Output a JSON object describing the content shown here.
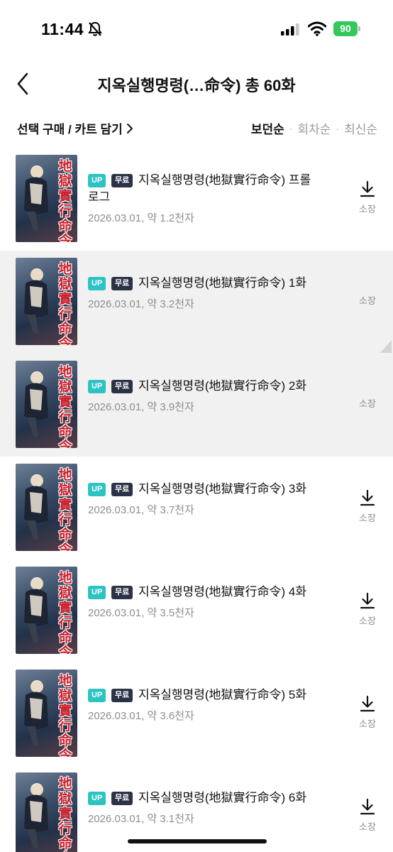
{
  "status_bar": {
    "time": "11:44",
    "battery": "90"
  },
  "header": {
    "title": "지옥실행명령(…命令) 총 60화"
  },
  "toolbar": {
    "select_label": "선택 구매 / 카트 담기",
    "sort_options": [
      "보던순",
      "회차순",
      "최신순"
    ],
    "sort_active": "보던순"
  },
  "episodes": [
    {
      "up": "UP",
      "free": "무료",
      "title": "지옥실행명령(地獄實行命令) 프롤로그",
      "meta": "2026.03.01, 약 1.2천자",
      "action": "소장",
      "read": false,
      "download": true,
      "cover_text": "地獄實行命令"
    },
    {
      "up": "UP",
      "free": "무료",
      "title": "지옥실행명령(地獄實行命令) 1화",
      "meta": "2026.03.01, 약 3.2천자",
      "action": "소장",
      "read": true,
      "download": false,
      "cover_text": "地獄實行命令"
    },
    {
      "up": "UP",
      "free": "무료",
      "title": "지옥실행명령(地獄實行命令) 2화",
      "meta": "2026.03.01, 약 3.9천자",
      "action": "소장",
      "read": true,
      "download": false,
      "cover_text": "地獄實行命令"
    },
    {
      "up": "UP",
      "free": "무료",
      "title": "지옥실행명령(地獄實行命令) 3화",
      "meta": "2026.03.01, 약 3.7천자",
      "action": "소장",
      "read": false,
      "download": true,
      "cover_text": "地獄實行命令"
    },
    {
      "up": "UP",
      "free": "무료",
      "title": "지옥실행명령(地獄實行命令) 4화",
      "meta": "2026.03.01, 약 3.5천자",
      "action": "소장",
      "read": false,
      "download": true,
      "cover_text": "地獄實行命令"
    },
    {
      "up": "UP",
      "free": "무료",
      "title": "지옥실행명령(地獄實行命令) 5화",
      "meta": "2026.03.01, 약 3.6천자",
      "action": "소장",
      "read": false,
      "download": true,
      "cover_text": "地獄實行命令"
    },
    {
      "up": "UP",
      "free": "무료",
      "title": "지옥실행명령(地獄實行命令) 6화",
      "meta": "2026.03.01, 약 3.1천자",
      "action": "소장",
      "read": false,
      "download": true,
      "cover_text": "地獄實行命令"
    }
  ],
  "icons": {
    "back": "chevron-left-icon",
    "download": "download-icon",
    "bell": "bell-slash-icon",
    "signal": "signal-icon",
    "wifi": "wifi-icon"
  },
  "colors": {
    "up_badge": "#2cc3c3",
    "free_badge": "#2b3246",
    "battery": "#34c759",
    "read_row": "#f1f1f1"
  }
}
